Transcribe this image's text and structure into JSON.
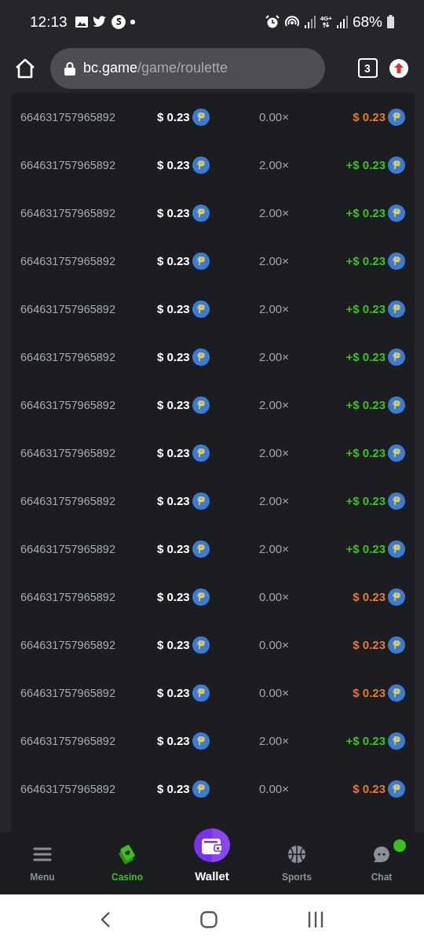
{
  "status_bar": {
    "time": "12:13",
    "network": "4G+",
    "battery": "68%"
  },
  "browser": {
    "domain": "bc.game",
    "path": "/game/roulette",
    "tab_count": "3"
  },
  "bets": [
    {
      "id": "664631757965892",
      "bet": "$ 0.23",
      "multiplier": "0.00×",
      "payout": "$ 0.23",
      "kind": "loss"
    },
    {
      "id": "664631757965892",
      "bet": "$ 0.23",
      "multiplier": "2.00×",
      "payout": "+$ 0.23",
      "kind": "win"
    },
    {
      "id": "664631757965892",
      "bet": "$ 0.23",
      "multiplier": "2.00×",
      "payout": "+$ 0.23",
      "kind": "win"
    },
    {
      "id": "664631757965892",
      "bet": "$ 0.23",
      "multiplier": "2.00×",
      "payout": "+$ 0.23",
      "kind": "win"
    },
    {
      "id": "664631757965892",
      "bet": "$ 0.23",
      "multiplier": "2.00×",
      "payout": "+$ 0.23",
      "kind": "win"
    },
    {
      "id": "664631757965892",
      "bet": "$ 0.23",
      "multiplier": "2.00×",
      "payout": "+$ 0.23",
      "kind": "win"
    },
    {
      "id": "664631757965892",
      "bet": "$ 0.23",
      "multiplier": "2.00×",
      "payout": "+$ 0.23",
      "kind": "win"
    },
    {
      "id": "664631757965892",
      "bet": "$ 0.23",
      "multiplier": "2.00×",
      "payout": "+$ 0.23",
      "kind": "win"
    },
    {
      "id": "664631757965892",
      "bet": "$ 0.23",
      "multiplier": "2.00×",
      "payout": "+$ 0.23",
      "kind": "win"
    },
    {
      "id": "664631757965892",
      "bet": "$ 0.23",
      "multiplier": "2.00×",
      "payout": "+$ 0.23",
      "kind": "win"
    },
    {
      "id": "664631757965892",
      "bet": "$ 0.23",
      "multiplier": "0.00×",
      "payout": "$ 0.23",
      "kind": "loss"
    },
    {
      "id": "664631757965892",
      "bet": "$ 0.23",
      "multiplier": "0.00×",
      "payout": "$ 0.23",
      "kind": "loss"
    },
    {
      "id": "664631757965892",
      "bet": "$ 0.23",
      "multiplier": "0.00×",
      "payout": "$ 0.23",
      "kind": "loss"
    },
    {
      "id": "664631757965892",
      "bet": "$ 0.23",
      "multiplier": "2.00×",
      "payout": "+$ 0.23",
      "kind": "win"
    },
    {
      "id": "664631757965892",
      "bet": "$ 0.23",
      "multiplier": "0.00×",
      "payout": "$ 0.23",
      "kind": "loss"
    }
  ],
  "bottom_nav": [
    {
      "label": "Menu",
      "kind": "menu",
      "selected": false
    },
    {
      "label": "Casino",
      "kind": "casino",
      "selected": true
    },
    {
      "label": "Wallet",
      "kind": "wallet",
      "selected": false
    },
    {
      "label": "Sports",
      "kind": "sports",
      "selected": false
    },
    {
      "label": "Chat",
      "kind": "chat",
      "selected": false,
      "unread": true
    }
  ]
}
